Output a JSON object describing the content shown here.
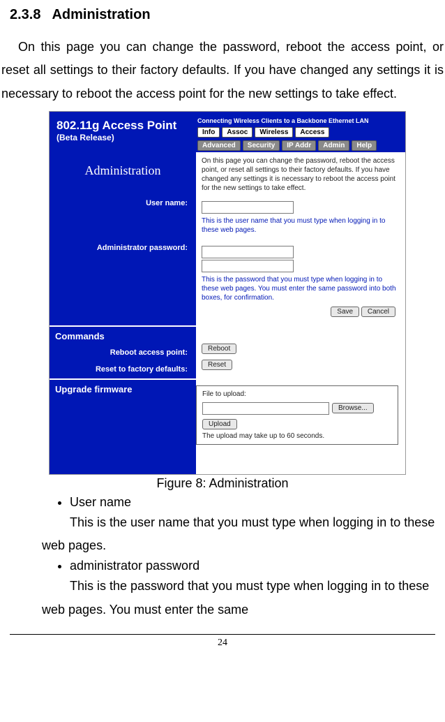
{
  "heading": {
    "number": "2.3.8",
    "title": "Administration"
  },
  "intro": "On this page you can change the password, reboot the access point, or reset all settings to their factory defaults. If you have changed any settings it is necessary to reboot the access point for the new settings to take effect.",
  "figure": {
    "banner_title": "802.11g Access Point",
    "banner_sub": "(Beta Release)",
    "banner_caption": "Connecting Wireless Clients to a Backbone Ethernet LAN",
    "tabs_row1": [
      "Info",
      "Assoc",
      "Wireless",
      "Access"
    ],
    "tabs_row2": [
      "Advanced",
      "Security",
      "IP Addr",
      "Admin",
      "Help"
    ],
    "admin_heading": "Administration",
    "admin_desc": "On this page you can change the password, reboot the access point, or reset all settings to their factory defaults. If you have changed any settings it is necessary to reboot the access point for the new settings to take effect.",
    "username_label": "User name:",
    "username_help": "This is the user name that you must type when logging in to these web pages.",
    "password_label": "Administrator password:",
    "password_help": "This is the password that you must type when logging in to these web pages. You must enter the same password into both boxes, for confirmation.",
    "save_btn": "Save",
    "cancel_btn": "Cancel",
    "commands_title": "Commands",
    "reboot_label": "Reboot access point:",
    "reboot_btn": "Reboot",
    "reset_label": "Reset to factory defaults:",
    "reset_btn": "Reset",
    "upgrade_title": "Upgrade firmware",
    "file_label": "File to upload:",
    "browse_btn": "Browse...",
    "upload_btn": "Upload",
    "upload_note": "The upload may take up to 60 seconds.",
    "caption": "Figure 8: Administration"
  },
  "bullets": {
    "b1_title": "User name",
    "b1_desc": "This is the user name that you must type when logging in to these web pages.",
    "b2_title": "administrator password",
    "b2_desc": "This is the password that you must type when logging in to these web pages. You must enter the same"
  },
  "page_number": "24"
}
